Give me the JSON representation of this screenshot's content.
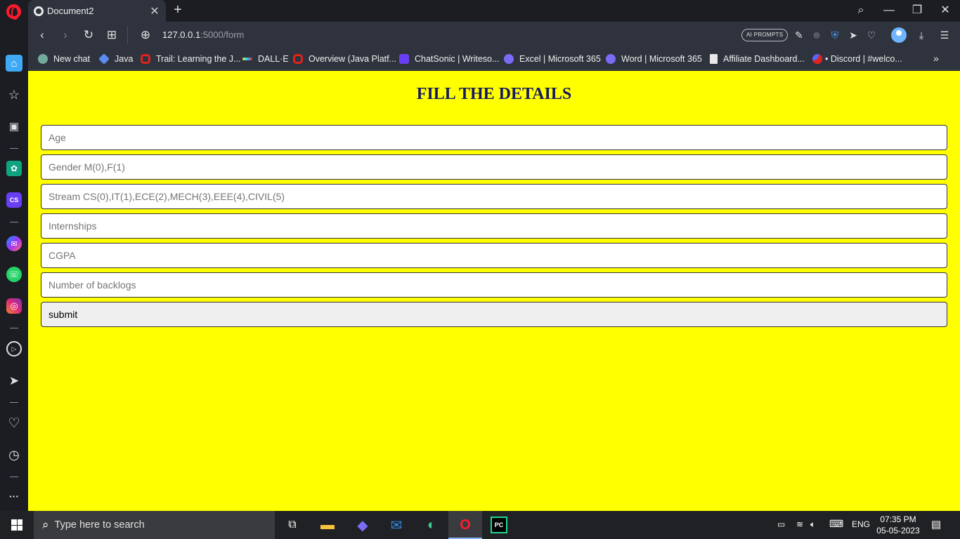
{
  "browser": {
    "tab": {
      "title": "Document2",
      "close_glyph": "✕"
    },
    "new_tab_glyph": "+",
    "window_controls": {
      "search_glyph": "⌕",
      "minimize_glyph": "—",
      "restore_glyph": "❐",
      "close_glyph": "✕"
    },
    "nav": {
      "back_glyph": "‹",
      "forward_glyph": "›",
      "reload_glyph": "↻",
      "tabs_glyph": "⊞"
    },
    "address": {
      "host": "127.0.0.1",
      "path": ":5000/form",
      "site_glyph": "⊕"
    },
    "ai_prompts_label": "AI PROMPTS",
    "toolbar_glyphs": {
      "edit": "✎",
      "camera": "⌾",
      "shield": "⛨",
      "send": "➤",
      "heart": "♡",
      "download": "⤓",
      "menu": "☰"
    },
    "bookmarks": [
      {
        "label": "New chat",
        "icon": "chatgpt-icon",
        "color": "#74aa9c"
      },
      {
        "label": "Java",
        "icon": "java-icon",
        "color": "#5b8def"
      },
      {
        "label": "Trail: Learning the J...",
        "icon": "oracle-icon",
        "color": "#e2231a"
      },
      {
        "label": "DALL·E",
        "icon": "dalle-icon",
        "color": "#ffd23f"
      },
      {
        "label": "Overview (Java Platf...",
        "icon": "oracle-icon",
        "color": "#e2231a"
      },
      {
        "label": "ChatSonic | Writeso...",
        "icon": "chatsonic-icon",
        "color": "#6a3ef5"
      },
      {
        "label": "Excel | Microsoft 365",
        "icon": "m365-icon",
        "color": "#7b6cf6"
      },
      {
        "label": "Word | Microsoft 365",
        "icon": "m365-icon",
        "color": "#7b6cf6"
      },
      {
        "label": "Affiliate Dashboard...",
        "icon": "document-icon",
        "color": "#e8e8e8"
      },
      {
        "label": "• Discord | #welco...",
        "icon": "discord-icon",
        "color": "#e2231a"
      }
    ],
    "bookmarks_more_glyph": "»"
  },
  "sidebar": {
    "home_glyph": "⌂",
    "items": [
      {
        "name": "star-icon",
        "glyph": "☆"
      },
      {
        "name": "briefcase-icon",
        "glyph": "▣"
      },
      {
        "name": "chatgpt-icon",
        "glyph": "✿"
      },
      {
        "name": "chatsonic-icon",
        "glyph": "CS"
      },
      {
        "name": "messenger-icon",
        "glyph": "✉"
      },
      {
        "name": "whatsapp-icon",
        "glyph": "☏"
      },
      {
        "name": "instagram-icon",
        "glyph": "◎"
      },
      {
        "name": "player-icon",
        "glyph": "▷"
      },
      {
        "name": "send-icon",
        "glyph": "➤"
      },
      {
        "name": "heart-icon",
        "glyph": "♡"
      },
      {
        "name": "history-icon",
        "glyph": "◷"
      },
      {
        "name": "more-icon",
        "glyph": "···"
      }
    ]
  },
  "form": {
    "title": "FILL THE DETAILS",
    "fields": [
      {
        "placeholder": "Age"
      },
      {
        "placeholder": "Gender M(0),F(1)"
      },
      {
        "placeholder": "Stream CS(0),IT(1),ECE(2),MECH(3),EEE(4),CIVIL(5)"
      },
      {
        "placeholder": "Internships"
      },
      {
        "placeholder": "CGPA"
      },
      {
        "placeholder": "Number of backlogs"
      }
    ],
    "submit_label": "submit"
  },
  "taskbar": {
    "search_placeholder": "Type here to search",
    "search_glyph": "⌕",
    "apps": [
      {
        "name": "task-view-icon",
        "glyph": "⧉"
      },
      {
        "name": "file-explorer-icon",
        "glyph": "▬"
      },
      {
        "name": "copilot-icon",
        "glyph": "◆"
      },
      {
        "name": "mail-icon",
        "glyph": "✉"
      },
      {
        "name": "edge-icon",
        "glyph": "◐"
      },
      {
        "name": "opera-icon",
        "glyph": "O"
      },
      {
        "name": "pycharm-icon",
        "glyph": "PC"
      }
    ],
    "tray": {
      "battery_glyph": "▭",
      "wifi_glyph": "≋",
      "volume_glyph": "🔈︎",
      "keyboard_glyph": "⌨",
      "language": "ENG"
    },
    "clock": {
      "time": "07:35 PM",
      "date": "05-05-2023"
    },
    "notification_glyph": "▤"
  },
  "colors": {
    "page_background": "#ffff00",
    "title_color": "#151863",
    "browser_chrome": "#2f333d",
    "opera_red": "#ff1b2d"
  }
}
